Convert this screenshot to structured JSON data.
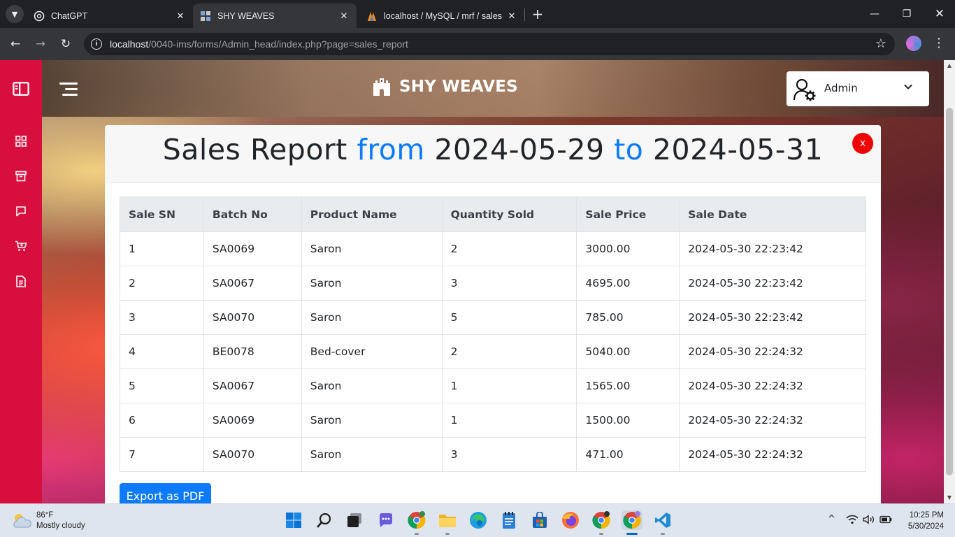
{
  "browser": {
    "tabs": [
      {
        "title": "ChatGPT",
        "active": false,
        "icon": "chatgpt-icon"
      },
      {
        "title": "SHY WEAVES",
        "active": true,
        "icon": "site-icon"
      },
      {
        "title": "localhost / MySQL / mrf / sales",
        "active": false,
        "icon": "phpmyadmin-icon"
      }
    ],
    "address": {
      "host": "localhost",
      "path": "/0040-ims/forms/Admin_head/index.php?page=sales_report"
    }
  },
  "header": {
    "brand": "SHY WEAVES",
    "user_label": "Admin"
  },
  "sidebar": {
    "icons": [
      "sidebar-toggle-icon",
      "dashboard-icon",
      "archive-icon",
      "message-icon",
      "cart-icon",
      "report-icon"
    ]
  },
  "report": {
    "title_prefix": "Sales Report",
    "from_word": "from",
    "from_date": "2024-05-29",
    "to_word": "to",
    "to_date": "2024-05-31",
    "close_label": "x",
    "columns": [
      "Sale SN",
      "Batch No",
      "Product Name",
      "Quantity Sold",
      "Sale Price",
      "Sale Date"
    ],
    "rows": [
      [
        "1",
        "SA0069",
        "Saron",
        "2",
        "3000.00",
        "2024-05-30 22:23:42"
      ],
      [
        "2",
        "SA0067",
        "Saron",
        "3",
        "4695.00",
        "2024-05-30 22:23:42"
      ],
      [
        "3",
        "SA0070",
        "Saron",
        "5",
        "785.00",
        "2024-05-30 22:23:42"
      ],
      [
        "4",
        "BE0078",
        "Bed-cover",
        "2",
        "5040.00",
        "2024-05-30 22:24:32"
      ],
      [
        "5",
        "SA0067",
        "Saron",
        "1",
        "1565.00",
        "2024-05-30 22:24:32"
      ],
      [
        "6",
        "SA0069",
        "Saron",
        "1",
        "1500.00",
        "2024-05-30 22:24:32"
      ],
      [
        "7",
        "SA0070",
        "Saron",
        "3",
        "471.00",
        "2024-05-30 22:24:32"
      ]
    ],
    "export_label": "Export as PDF"
  },
  "taskbar": {
    "weather_temp": "86°F",
    "weather_desc": "Mostly cloudy",
    "time": "10:25 PM",
    "date": "5/30/2024"
  },
  "colors": {
    "sidebar": "#d80f3e",
    "accent_blue": "#0d7bff",
    "close_red": "#f00000"
  }
}
